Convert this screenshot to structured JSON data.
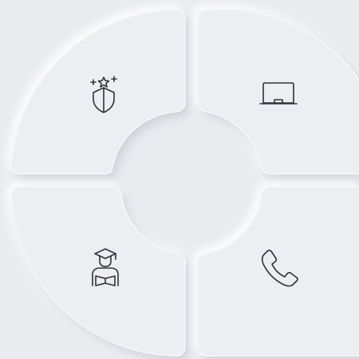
{
  "radial_menu": {
    "segments": [
      {
        "id": "top-left",
        "icon": "shield-stars-icon"
      },
      {
        "id": "top-right",
        "icon": "laptop-icon"
      },
      {
        "id": "bottom-left",
        "icon": "graduate-student-icon"
      },
      {
        "id": "bottom-right",
        "icon": "phone-icon"
      }
    ],
    "colors": {
      "background": "#eaebef",
      "segment": "#eceef2",
      "highlight": "#ffffff",
      "shadow": "#c9ccd3",
      "icon_stroke": "#2e3238"
    }
  }
}
